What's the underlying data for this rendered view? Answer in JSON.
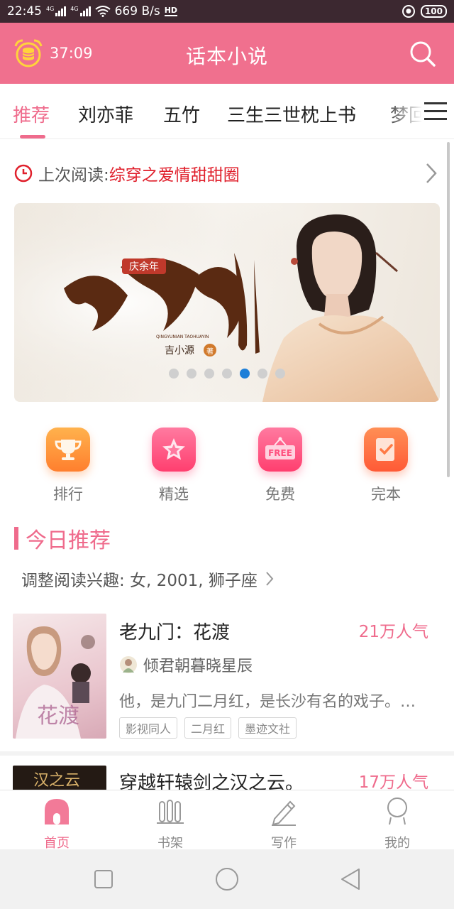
{
  "status_bar": {
    "time": "22:45",
    "network_speed": "669 B/s",
    "battery": "100",
    "icons": [
      "signal-4g-icon",
      "signal-4g-icon",
      "wifi-icon",
      "hd-icon",
      "lock-icon",
      "battery-icon"
    ]
  },
  "header": {
    "timer": "37:09",
    "title": "话本小说",
    "timer_icon": "alarm-clock-coin-icon",
    "search_icon": "search-icon"
  },
  "tabs": {
    "items": [
      {
        "label": "推荐",
        "active": true
      },
      {
        "label": "刘亦菲",
        "active": false
      },
      {
        "label": "五竹",
        "active": false
      },
      {
        "label": "三生三世枕上书",
        "active": false
      },
      {
        "label": "梦回",
        "active": false
      }
    ],
    "menu_icon": "menu-icon"
  },
  "last_read": {
    "label": "上次阅读:",
    "title": "综穿之爱情甜甜圈"
  },
  "banner": {
    "slide_count": 7,
    "active_slide": 5,
    "text_series": "庆余年",
    "text_title": "桃花引",
    "text_author": "吉小源",
    "text_author_mark": "著",
    "text_pinyin": "QINGYUNIAN TAOHUAYIN"
  },
  "quick_entries": [
    {
      "label": "排行",
      "icon": "trophy-icon",
      "color": "#ff8a3d"
    },
    {
      "label": "精选",
      "icon": "star-icon",
      "color": "#ff4f7e"
    },
    {
      "label": "免费",
      "icon": "free-sign-icon",
      "color": "#ff4f7e",
      "badge": "FREE"
    },
    {
      "label": "完本",
      "icon": "check-book-icon",
      "color": "#ff6a3d"
    }
  ],
  "section": {
    "title": "今日推荐",
    "interest_text": "调整阅读兴趣: 女, 2001, 狮子座"
  },
  "books": [
    {
      "title": "老九门：花渡",
      "popularity": "21万人气",
      "author": "倾君朝暮晓星辰",
      "description": "他，是九门二月红，是长沙有名的戏子。…",
      "tags": [
        "影视同人",
        "二月红",
        "墨迹文社"
      ],
      "cover_text": "花渡"
    },
    {
      "title": "穿越轩辕剑之汉之云。",
      "popularity": "17万人气",
      "cover_text": "汉之云"
    }
  ],
  "bottom_nav": [
    {
      "label": "首页",
      "icon": "home-icon",
      "active": true
    },
    {
      "label": "书架",
      "icon": "bookshelf-icon",
      "active": false
    },
    {
      "label": "写作",
      "icon": "pencil-icon",
      "active": false
    },
    {
      "label": "我的",
      "icon": "profile-icon",
      "active": false
    }
  ],
  "system_nav": [
    "square-recents-icon",
    "circle-home-icon",
    "triangle-back-icon"
  ],
  "colors": {
    "accent": "#f0708e",
    "status_bar": "#3c2830",
    "last_read_title": "#e0202c",
    "banner_dot_active": "#1e7fd8"
  }
}
